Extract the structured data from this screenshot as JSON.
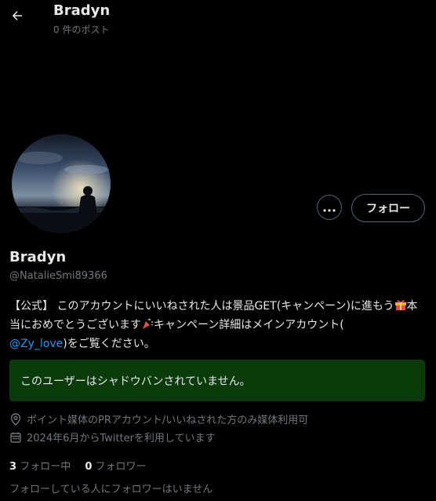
{
  "header": {
    "title": "Bradyn",
    "post_count": "0 件のポスト"
  },
  "actions": {
    "follow_label": "フォロー",
    "more_icon": "ellipsis-icon"
  },
  "profile": {
    "name": "Bradyn",
    "handle": "@NatalieSmi89366",
    "bio_part1": "【公式】 このアカウントにいいねされた人は景品GET(キャンペーン)に進もう",
    "bio_part2": "本当におめでとうございます",
    "bio_part3": "キャンペーン詳細はメインアカウント(",
    "bio_mention": "@Zy_love",
    "bio_part4": ")をご覧ください。",
    "bio_emojis": [
      "gift-emoji",
      "party-popper-emoji"
    ],
    "location": "ポイント媒体のPRアカウント/いいねされた方のみ媒体利用可",
    "joined": "2024年6月からTwitterを利用しています"
  },
  "notice": {
    "text": "このユーザーはシャドウバンされていません。",
    "background": "#0b3b0b"
  },
  "stats": {
    "following_count": "3",
    "following_label": "フォロー中",
    "followers_count": "0",
    "followers_label": "フォロワー",
    "followed_by_note": "フォローしている人にフォロワーはいません"
  },
  "colors": {
    "background": "#000000",
    "text": "#e7e9ea",
    "secondary": "#71767b",
    "link": "#1d9bf0",
    "border": "#536471"
  }
}
